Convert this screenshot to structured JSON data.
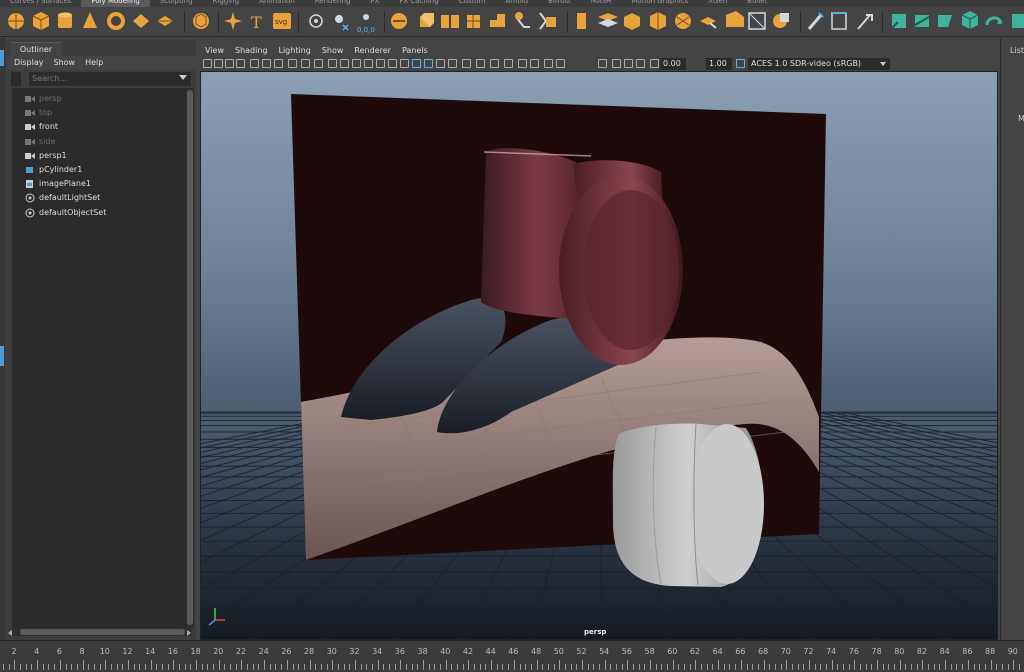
{
  "shelf_tabs": [
    "Curves / Surfaces",
    "Poly Modeling",
    "Sculpting",
    "Rigging",
    "Animation",
    "Rendering",
    "FX",
    "FX Caching",
    "Custom",
    "Arnold",
    "Bifrost",
    "MASH",
    "Motion Graphics",
    "XGen",
    "Bullet"
  ],
  "active_shelf_tab": "Poly Modeling",
  "shelf": {
    "text_tool_label": "T",
    "svg_tool_label": "svg"
  },
  "outliner": {
    "tab_label": "Outliner",
    "menu": [
      "Display",
      "Show",
      "Help"
    ],
    "search_placeholder": "Search...",
    "items": [
      {
        "label": "persp",
        "icon": "camera-icon",
        "dim": true
      },
      {
        "label": "top",
        "icon": "camera-icon",
        "dim": true
      },
      {
        "label": "front",
        "icon": "camera-icon",
        "dim": false
      },
      {
        "label": "side",
        "icon": "camera-icon",
        "dim": true
      },
      {
        "label": "persp1",
        "icon": "camera-icon",
        "dim": false
      },
      {
        "label": "pCylinder1",
        "icon": "mesh-icon",
        "dim": false
      },
      {
        "label": "imagePlane1",
        "icon": "image-plane-icon",
        "dim": false
      },
      {
        "label": "defaultLightSet",
        "icon": "set-icon",
        "dim": false
      },
      {
        "label": "defaultObjectSet",
        "icon": "set-icon",
        "dim": false
      }
    ]
  },
  "viewport": {
    "menu": [
      "View",
      "Shading",
      "Lighting",
      "Show",
      "Renderer",
      "Panels"
    ],
    "exposure": "0.00",
    "gamma": "1.00",
    "color_space": "ACES 1.0 SDR-video (sRGB)",
    "camera_label": "persp"
  },
  "right_panel": {
    "label": "List",
    "label2": "M"
  },
  "timeline": {
    "ticks": [
      "2",
      "4",
      "6",
      "8",
      "10",
      "12",
      "14",
      "16",
      "18",
      "20",
      "22",
      "24",
      "26",
      "28",
      "30",
      "32",
      "34",
      "36",
      "38",
      "40",
      "42",
      "44",
      "46",
      "48",
      "50",
      "52",
      "54",
      "56",
      "58",
      "60",
      "62",
      "64",
      "66",
      "68",
      "70",
      "72",
      "74",
      "76",
      "78",
      "80",
      "82",
      "84",
      "86",
      "88",
      "90"
    ]
  },
  "colors": {
    "shelf_accent": "#e8a33d",
    "shelf_teal": "#3fb39b",
    "selection_blue": "#4b9dd6",
    "image_plane_bg": "#1e0a0a"
  }
}
